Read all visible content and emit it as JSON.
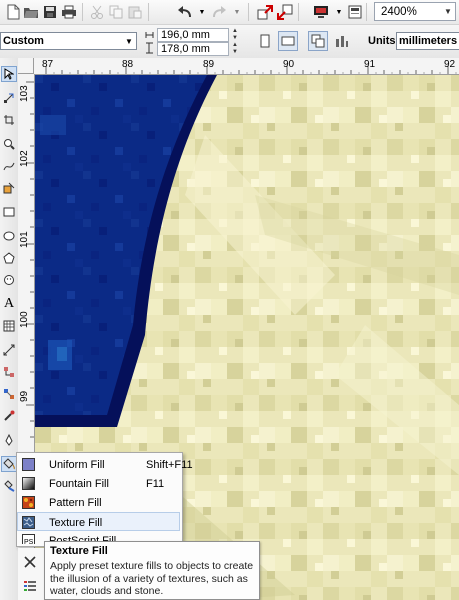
{
  "toolbar": {
    "zoom_value": "2400%"
  },
  "property_bar": {
    "preset": "Custom",
    "width": "196,0 mm",
    "height": "178,0 mm",
    "units_label": "Units:",
    "units_value": "millimeters"
  },
  "rulers": {
    "horizontal": [
      "87",
      "88",
      "89",
      "90",
      "91",
      "92"
    ],
    "vertical": [
      "103",
      "102",
      "101",
      "100",
      "99"
    ]
  },
  "fill_flyout": {
    "items": [
      {
        "label": "Uniform Fill",
        "shortcut": "Shift+F11",
        "icon": "uniform-fill-icon"
      },
      {
        "label": "Fountain Fill",
        "shortcut": "F11",
        "icon": "fountain-fill-icon"
      },
      {
        "label": "Pattern Fill",
        "shortcut": "",
        "icon": "pattern-fill-icon"
      },
      {
        "label": "Texture Fill",
        "shortcut": "",
        "icon": "texture-fill-icon"
      },
      {
        "label": "PostScript Fill",
        "shortcut": "",
        "icon": "postscript-fill-icon"
      }
    ]
  },
  "tooltip": {
    "title": "Texture Fill",
    "body": "Apply preset texture fills to objects to create the illusion of a variety of textures, such as water, clouds and stone."
  },
  "colors": {
    "canvas_light": "#eae6b8",
    "object_fill": "#0a1f78",
    "object_outline": "#05105a"
  }
}
